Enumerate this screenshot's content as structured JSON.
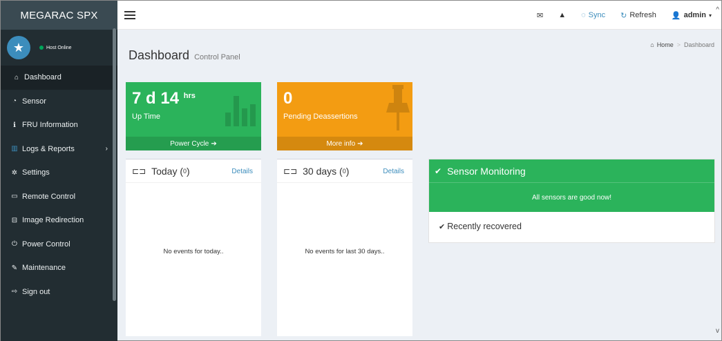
{
  "brand": "MEGARAC SPX",
  "user_panel": {
    "status": "Host Online"
  },
  "sidebar": {
    "items": [
      {
        "label": "Dashboard",
        "icon": "home-icon"
      },
      {
        "label": "Sensor",
        "icon": "dashboard-icon"
      },
      {
        "label": "FRU Information",
        "icon": "info-icon"
      },
      {
        "label": "Logs & Reports",
        "icon": "bar-chart-icon"
      },
      {
        "label": "Settings",
        "icon": "gear-icon"
      },
      {
        "label": "Remote Control",
        "icon": "monitor-icon"
      },
      {
        "label": "Image Redirection",
        "icon": "drive-icon"
      },
      {
        "label": "Power Control",
        "icon": "power-icon"
      },
      {
        "label": "Maintenance",
        "icon": "wrench-icon"
      },
      {
        "label": "Sign out",
        "icon": "sign-out-icon"
      }
    ]
  },
  "header": {
    "sync": "Sync",
    "refresh": "Refresh",
    "user": "admin"
  },
  "page": {
    "title": "Dashboard",
    "subtitle": "Control Panel",
    "breadcrumb_home": "Home",
    "breadcrumb_current": "Dashboard"
  },
  "uptime": {
    "days": "7 d 14",
    "unit": "hrs",
    "label": "Up Time",
    "footer": "Power Cycle"
  },
  "pending": {
    "value": "0",
    "label": "Pending Deassertions",
    "footer": "More info"
  },
  "today": {
    "title": "Today",
    "count": "0",
    "details": "Details",
    "empty": "No events for today.."
  },
  "days30": {
    "title": "30 days",
    "count": "0",
    "details": "Details",
    "empty": "No events for last 30 days.."
  },
  "sensor": {
    "title": "Sensor Monitoring",
    "message": "All sensors are good now!",
    "recovered": "Recently recovered"
  },
  "colors": {
    "green": "#2bb35b",
    "orange": "#f39c12",
    "sidebar": "#222d32",
    "link": "#3c8dbc"
  }
}
